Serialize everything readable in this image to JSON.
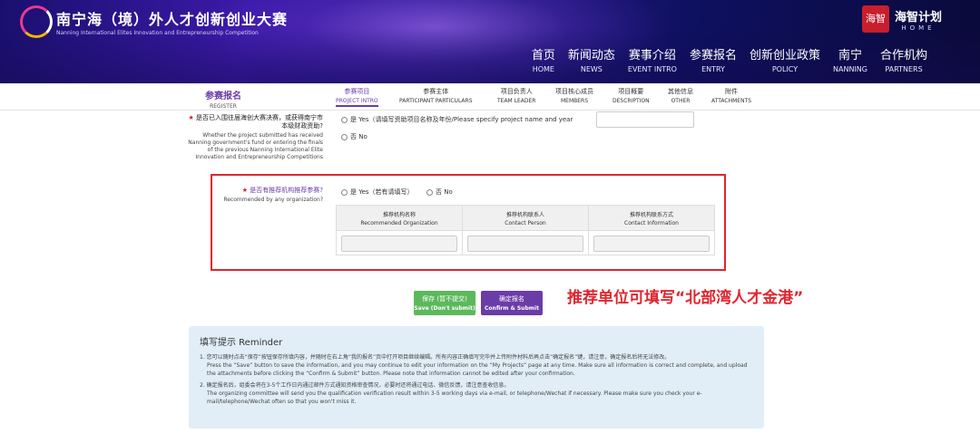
{
  "header": {
    "logo_title": "南宁海（境）外人才创新创业大赛",
    "logo_subtitle": "Nanning International Elites Innovation and Entrepreneurship Competition",
    "brand_seal": "海智",
    "brand_cn": "海智计划",
    "brand_en": "HOME",
    "nav": [
      {
        "cn": "首页",
        "en": "HOME"
      },
      {
        "cn": "新闻动态",
        "en": "NEWS"
      },
      {
        "cn": "赛事介绍",
        "en": "EVENT INTRO"
      },
      {
        "cn": "参赛报名",
        "en": "ENTRY"
      },
      {
        "cn": "创新创业政策",
        "en": "POLICY"
      },
      {
        "cn": "南宁",
        "en": "NANNING"
      },
      {
        "cn": "合作机构",
        "en": "PARTNERS"
      }
    ]
  },
  "tabs": {
    "register_cn": "参赛报名",
    "register_en": "REGISTER",
    "items": [
      {
        "cn": "参赛项目",
        "en": "PROJECT INTRO"
      },
      {
        "cn": "参赛主体",
        "en": "PARTICIPANT PARTICULARS"
      },
      {
        "cn": "项目负责人",
        "en": "TEAM LEADER"
      },
      {
        "cn": "项目核心成员",
        "en": "MEMBERS"
      },
      {
        "cn": "项目概要",
        "en": "DESCRIPTION"
      },
      {
        "cn": "其他信息",
        "en": "OTHER"
      },
      {
        "cn": "附件",
        "en": "ATTACHMENTS"
      }
    ]
  },
  "form": {
    "q1_star": "★",
    "q1_cn": "是否已入围往届海创大赛决赛，或获得南宁市本级财政资助?",
    "q1_en": "Whether the project submitted has received Nanning government's fund or entering the finals of the previous Nanning International Elite Innovation and Entrepreneurship Competitions",
    "q1_yes": "是 Yes（请填写资助项目名称及年份/Please specify project name and year",
    "q1_no": "否 No",
    "q2_star": "★",
    "q2_cn": "是否有推荐机构推荐参赛?",
    "q2_en": "Recommended by any organization?",
    "q2_yes": "是 Yes（若有请填写）",
    "q2_no": "否 No",
    "org_table": {
      "headers": [
        {
          "cn": "推荐机构名称",
          "en": "Recommended Organization"
        },
        {
          "cn": "推荐机构联系人",
          "en": "Contact Person"
        },
        {
          "cn": "推荐机构联系方式",
          "en": "Contact Information"
        }
      ]
    }
  },
  "buttons": {
    "save_cn": "保存 (暂不提交)",
    "save_en": "Save (Don't submit)",
    "submit_cn": "确定报名",
    "submit_en": "Confirm & Submit"
  },
  "annotation": "推荐单位可填写“北部湾人才金港”",
  "reminder": {
    "title": "填写提示 Reminder",
    "items": [
      "1. 您可以随时点击“保存”按钮保存所填内容，并随时在右上角“我的报名”页中打开项目继续编辑。所有内容正确填写完毕并上传附件材料后再点击“确定报名”键，请注意，确定报名后将无法修改。",
      "Press the “Save” button to save the information, and you may continue to edit your information on the “My Projects” page at any time. Make sure all information is correct and complete, and upload the attachments before clicking the “Confirm & Submit” button. Please note that information cannot be edited after your confirmation.",
      "2. 确定报名后，组委会将在3-5个工作日内通过邮件方式通知资格审查情况，必要时还将通过电话、微信反馈，请注意查收信息。",
      "The organizing committee will send you the qualification verification result within 3-5 working days via e-mail, or telephone/Wechat if necessary. Please make sure you check your e-mail/telephone/Wechat often so that you won't miss it."
    ]
  }
}
